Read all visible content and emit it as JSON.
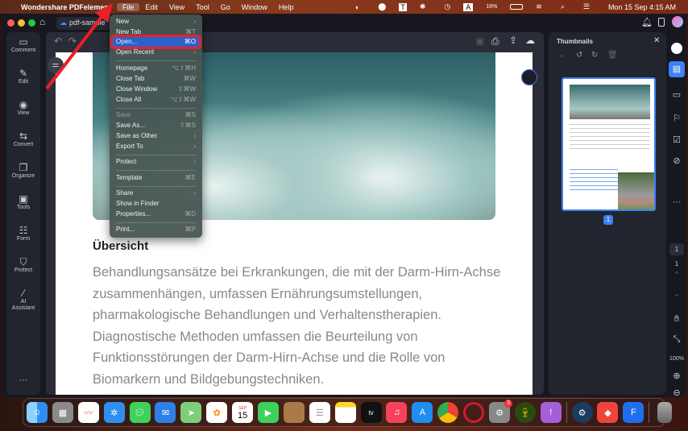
{
  "menubar": {
    "app": "Wondershare PDFelement",
    "items": [
      "File",
      "Edit",
      "View",
      "Tool",
      "Go",
      "Window",
      "Help"
    ],
    "battery": "16%",
    "datetime": "Mon 15 Sep  4:15 AM"
  },
  "tab": {
    "title": "pdf-sample"
  },
  "leftbar": [
    "Comment",
    "Edit",
    "View",
    "Convert",
    "Organize",
    "Tools",
    "Form",
    "Protect",
    "AI Assistant"
  ],
  "document": {
    "heading": "Übersicht",
    "paragraph": "Behandlungsansätze bei Erkrankungen, die mit der Darm-Hirn-Achse zusammenhängen, umfassen Ernährungsumstellungen, pharmakologische Behandlungen und Verhaltenstherapien. Diagnostische Methoden umfassen die Beurteilung von Funktionsstörungen der Darm-Hirn-Achse und die Rolle von Biomarkern und Bildgebungstechniken."
  },
  "thumbnails": {
    "title": "Thumbnails",
    "page_badge": "1"
  },
  "rightstrip": {
    "page_input": "1",
    "page_total": "1",
    "zoom": "100%"
  },
  "file_menu": [
    {
      "label": "New",
      "shortcut": "›"
    },
    {
      "label": "New Tab",
      "shortcut": "⌘T"
    },
    {
      "label": "Open...",
      "shortcut": "⌘O",
      "highlighted": true
    },
    {
      "label": "Open Recent",
      "shortcut": "›"
    },
    {
      "label": "Homepage",
      "shortcut": "⌥⇧⌘H"
    },
    {
      "label": "Close Tab",
      "shortcut": "⌘W"
    },
    {
      "label": "Close Window",
      "shortcut": "⇧⌘W"
    },
    {
      "label": "Close All",
      "shortcut": "⌥⇧⌘W"
    },
    {
      "label": "Save",
      "shortcut": "⌘S",
      "disabled": true
    },
    {
      "label": "Save As...",
      "shortcut": "⇧⌘S"
    },
    {
      "label": "Save as Other",
      "shortcut": "›"
    },
    {
      "label": "Export To",
      "shortcut": "›"
    },
    {
      "label": "Protect",
      "shortcut": "›"
    },
    {
      "label": "Template",
      "shortcut": "⌘E"
    },
    {
      "label": "Share",
      "shortcut": "›"
    },
    {
      "label": "Show in Finder",
      "shortcut": ""
    },
    {
      "label": "Properties...",
      "shortcut": "⌘D"
    },
    {
      "label": "Print...",
      "shortcut": "⌘P"
    }
  ],
  "dock": {
    "calendar_month": "SEP",
    "calendar_day": "15",
    "settings_badge": "3",
    "apps": [
      "Finder",
      "Launchpad",
      "Freeform",
      "Safari",
      "Messages",
      "Mail",
      "Maps",
      "Photos",
      "Calendar",
      "FaceTime",
      "Notes App",
      "Reminders",
      "Notes",
      "TV",
      "Music",
      "App Store",
      "Chrome",
      "Opera",
      "System Settings",
      "Wine",
      "Feedback",
      "Steam",
      "AnyDesk",
      "PDFelement",
      "Trash"
    ]
  },
  "colors": {
    "accent": "#2a62c9",
    "annotation": "#e8202a"
  }
}
